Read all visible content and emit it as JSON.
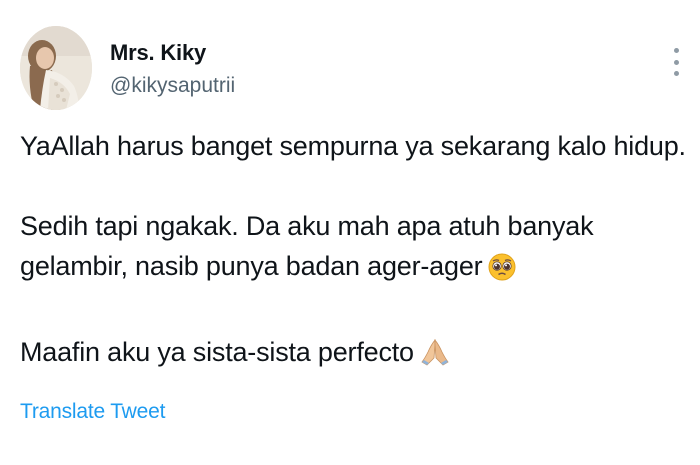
{
  "user": {
    "display_name": "Mrs. Kiky",
    "handle": "@kikysaputrii"
  },
  "header": {
    "more_icon": "more-vertical-icon"
  },
  "tweet": {
    "line1": "YaAllah harus banget sempurna ya sekarang kalo hidup.",
    "line2": "Sedih tapi ngakak. Da aku mah apa atuh banyak",
    "line3": "gelambir, nasib punya badan ager-ager",
    "line3_emoji": "pleading-face-icon",
    "line4": "Maafin aku ya sista-sista perfecto",
    "line4_emoji": "folded-hands-icon"
  },
  "actions": {
    "translate_label": "Translate Tweet"
  },
  "colors": {
    "text": "#0f1419",
    "secondary": "#536471",
    "link": "#1d9bf0"
  }
}
